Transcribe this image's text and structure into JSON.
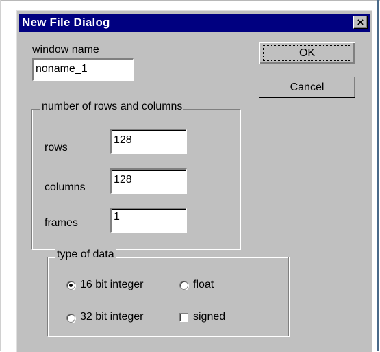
{
  "dialog": {
    "title": "New File Dialog",
    "close_glyph": "×"
  },
  "window_name": {
    "label": "window name",
    "value": "noname_1"
  },
  "buttons": {
    "ok": "OK",
    "cancel": "Cancel"
  },
  "dimensions": {
    "legend": "number of rows and columns",
    "rows_label": "rows",
    "rows_value": "128",
    "columns_label": "columns",
    "columns_value": "128",
    "frames_label": "frames",
    "frames_value": "1"
  },
  "data_type": {
    "legend": "type of data",
    "opt_16bit": "16 bit integer",
    "opt_float": "float",
    "opt_32bit": "32 bit integer",
    "opt_signed": "signed",
    "selected": "16 bit integer",
    "signed_checked": false
  },
  "colors": {
    "titlebar": "#000080",
    "face": "#c0c0c0"
  }
}
